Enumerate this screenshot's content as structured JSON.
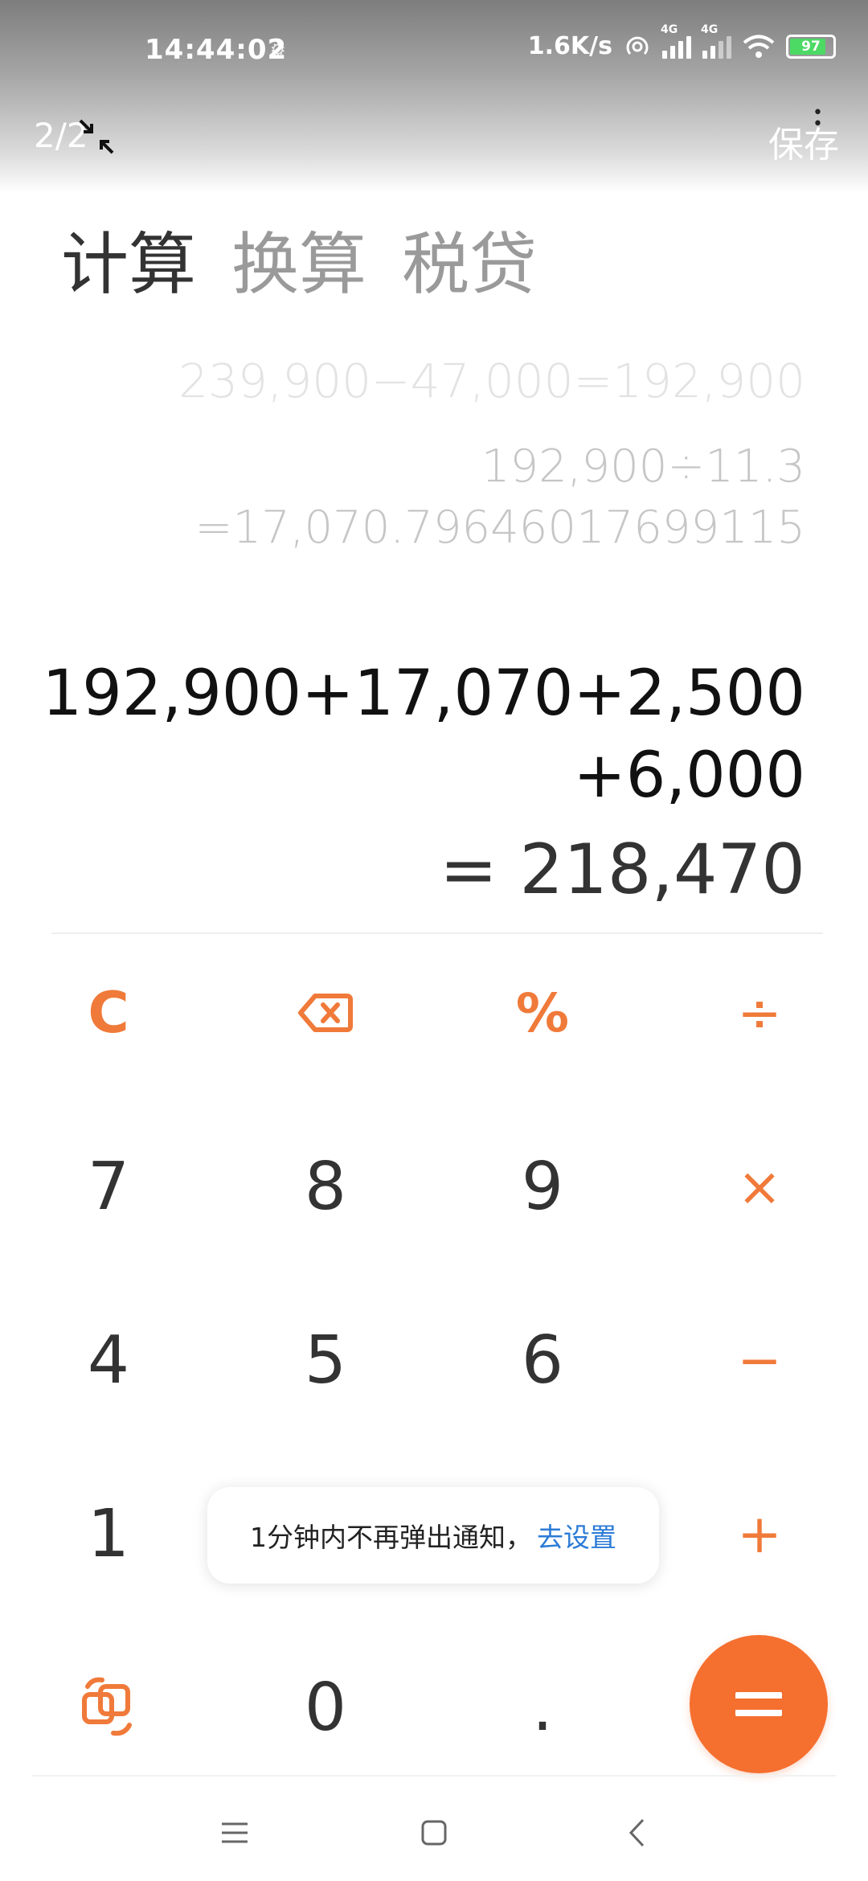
{
  "status_bar": {
    "time": "14:44:02",
    "net_speed": "1.6K/s",
    "sim_labels": [
      "4G",
      "4G"
    ],
    "battery": "97"
  },
  "viewer": {
    "page_counter": "2/2",
    "save_label": "保存"
  },
  "tabs": [
    {
      "label": "计算",
      "active": true
    },
    {
      "label": "换算",
      "active": false
    },
    {
      "label": "税贷",
      "active": false
    }
  ],
  "history": [
    "239,900−47,000=192,900",
    "192,900÷11.3",
    "=17,070.79646017699115"
  ],
  "expression": {
    "line1": "192,900+17,070+2,500",
    "line2": "+6,000"
  },
  "result": "= 218,470",
  "keypad": {
    "clear": "C",
    "backspace_icon": "backspace-icon",
    "percent": "%",
    "divide": "÷",
    "multiply": "×",
    "minus": "−",
    "plus": "+",
    "k7": "7",
    "k8": "8",
    "k9": "9",
    "k4": "4",
    "k5": "5",
    "k6": "6",
    "k1": "1",
    "k0": "0",
    "dot": ".",
    "switch_icon": "rotate-switch-icon",
    "equals_icon": "equals-icon"
  },
  "toast": {
    "text": "1分钟内不再弹出通知，",
    "link": "去设置"
  },
  "colors": {
    "accent": "#f56f2f",
    "operator": "#f07a3a",
    "link": "#2b7bd6"
  }
}
